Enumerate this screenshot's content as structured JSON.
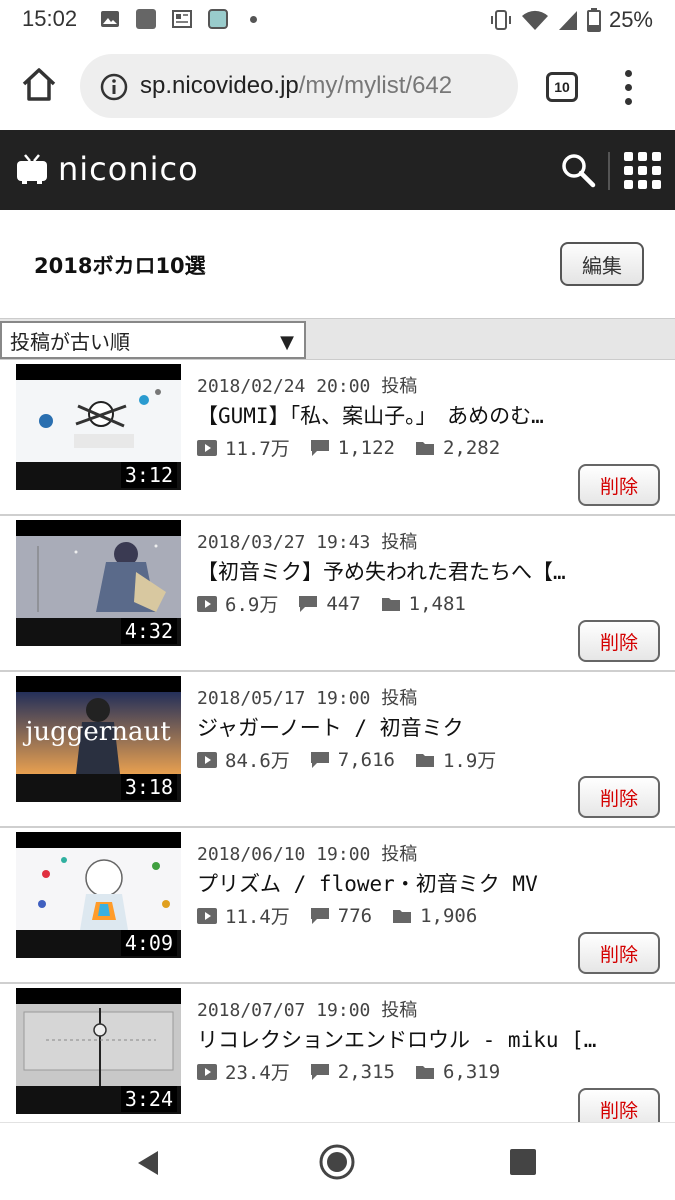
{
  "status_bar": {
    "time": "15:02",
    "battery": "25%",
    "icons": [
      "image-icon",
      "square-app-icon",
      "news-icon",
      "avatar-icon",
      "dot-icon",
      "vibrate-icon",
      "wifi-icon",
      "signal-icon",
      "battery-icon"
    ]
  },
  "browser": {
    "url_domain": "sp.nicovideo.jp",
    "url_path": "/my/mylist/642",
    "tab_count": "10"
  },
  "header": {
    "logo_text": "niconico"
  },
  "mylist": {
    "title": "2018ボカロ10選",
    "edit_label": "編集",
    "sort_label": "投稿が古い順",
    "sort_arrow": "▼"
  },
  "items": [
    {
      "date": "2018/02/24 20:00 投稿",
      "title": "【GUMI】「私、案山子。」　あめのむ…",
      "views": "11.7万",
      "comments": "1,122",
      "mylists": "2,282",
      "duration": "3:12",
      "delete_label": "削除"
    },
    {
      "date": "2018/03/27 19:43 投稿",
      "title": "【初音ミク】予め失われた君たちへ【…",
      "views": "6.9万",
      "comments": "447",
      "mylists": "1,481",
      "duration": "4:32",
      "delete_label": "削除"
    },
    {
      "date": "2018/05/17 19:00 投稿",
      "title": "ジャガーノート / 初音ミク",
      "views": "84.6万",
      "comments": "7,616",
      "mylists": "1.9万",
      "duration": "3:18",
      "thumb_text": "juggernaut",
      "delete_label": "削除"
    },
    {
      "date": "2018/06/10 19:00 投稿",
      "title": "プリズム / flower・初音ミク MV",
      "views": "11.4万",
      "comments": "776",
      "mylists": "1,906",
      "duration": "4:09",
      "delete_label": "削除"
    },
    {
      "date": "2018/07/07 19:00 投稿",
      "title": "リコレクションエンドロウル - miku […",
      "views": "23.4万",
      "comments": "2,315",
      "mylists": "6,319",
      "duration": "3:24",
      "delete_label": "削除"
    }
  ],
  "colors": {
    "header_bg": "#222222",
    "delete_text": "#d40000",
    "sort_bar_bg": "#e6e6e6"
  }
}
